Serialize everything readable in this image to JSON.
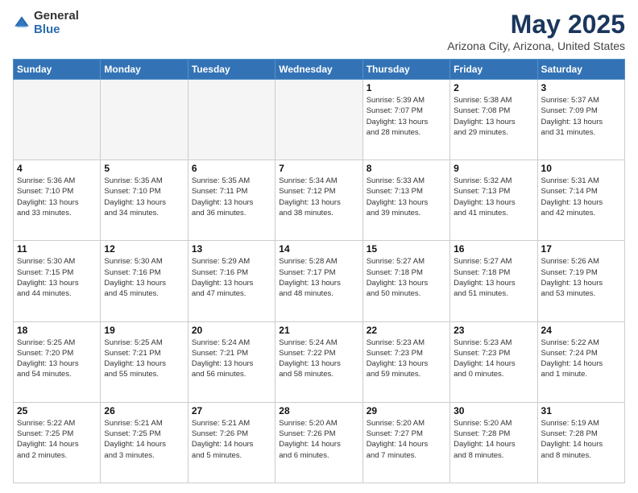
{
  "logo": {
    "general": "General",
    "blue": "Blue"
  },
  "title": "May 2025",
  "subtitle": "Arizona City, Arizona, United States",
  "weekdays": [
    "Sunday",
    "Monday",
    "Tuesday",
    "Wednesday",
    "Thursday",
    "Friday",
    "Saturday"
  ],
  "weeks": [
    [
      {
        "day": "",
        "info": ""
      },
      {
        "day": "",
        "info": ""
      },
      {
        "day": "",
        "info": ""
      },
      {
        "day": "",
        "info": ""
      },
      {
        "day": "1",
        "info": "Sunrise: 5:39 AM\nSunset: 7:07 PM\nDaylight: 13 hours\nand 28 minutes."
      },
      {
        "day": "2",
        "info": "Sunrise: 5:38 AM\nSunset: 7:08 PM\nDaylight: 13 hours\nand 29 minutes."
      },
      {
        "day": "3",
        "info": "Sunrise: 5:37 AM\nSunset: 7:09 PM\nDaylight: 13 hours\nand 31 minutes."
      }
    ],
    [
      {
        "day": "4",
        "info": "Sunrise: 5:36 AM\nSunset: 7:10 PM\nDaylight: 13 hours\nand 33 minutes."
      },
      {
        "day": "5",
        "info": "Sunrise: 5:35 AM\nSunset: 7:10 PM\nDaylight: 13 hours\nand 34 minutes."
      },
      {
        "day": "6",
        "info": "Sunrise: 5:35 AM\nSunset: 7:11 PM\nDaylight: 13 hours\nand 36 minutes."
      },
      {
        "day": "7",
        "info": "Sunrise: 5:34 AM\nSunset: 7:12 PM\nDaylight: 13 hours\nand 38 minutes."
      },
      {
        "day": "8",
        "info": "Sunrise: 5:33 AM\nSunset: 7:13 PM\nDaylight: 13 hours\nand 39 minutes."
      },
      {
        "day": "9",
        "info": "Sunrise: 5:32 AM\nSunset: 7:13 PM\nDaylight: 13 hours\nand 41 minutes."
      },
      {
        "day": "10",
        "info": "Sunrise: 5:31 AM\nSunset: 7:14 PM\nDaylight: 13 hours\nand 42 minutes."
      }
    ],
    [
      {
        "day": "11",
        "info": "Sunrise: 5:30 AM\nSunset: 7:15 PM\nDaylight: 13 hours\nand 44 minutes."
      },
      {
        "day": "12",
        "info": "Sunrise: 5:30 AM\nSunset: 7:16 PM\nDaylight: 13 hours\nand 45 minutes."
      },
      {
        "day": "13",
        "info": "Sunrise: 5:29 AM\nSunset: 7:16 PM\nDaylight: 13 hours\nand 47 minutes."
      },
      {
        "day": "14",
        "info": "Sunrise: 5:28 AM\nSunset: 7:17 PM\nDaylight: 13 hours\nand 48 minutes."
      },
      {
        "day": "15",
        "info": "Sunrise: 5:27 AM\nSunset: 7:18 PM\nDaylight: 13 hours\nand 50 minutes."
      },
      {
        "day": "16",
        "info": "Sunrise: 5:27 AM\nSunset: 7:18 PM\nDaylight: 13 hours\nand 51 minutes."
      },
      {
        "day": "17",
        "info": "Sunrise: 5:26 AM\nSunset: 7:19 PM\nDaylight: 13 hours\nand 53 minutes."
      }
    ],
    [
      {
        "day": "18",
        "info": "Sunrise: 5:25 AM\nSunset: 7:20 PM\nDaylight: 13 hours\nand 54 minutes."
      },
      {
        "day": "19",
        "info": "Sunrise: 5:25 AM\nSunset: 7:21 PM\nDaylight: 13 hours\nand 55 minutes."
      },
      {
        "day": "20",
        "info": "Sunrise: 5:24 AM\nSunset: 7:21 PM\nDaylight: 13 hours\nand 56 minutes."
      },
      {
        "day": "21",
        "info": "Sunrise: 5:24 AM\nSunset: 7:22 PM\nDaylight: 13 hours\nand 58 minutes."
      },
      {
        "day": "22",
        "info": "Sunrise: 5:23 AM\nSunset: 7:23 PM\nDaylight: 13 hours\nand 59 minutes."
      },
      {
        "day": "23",
        "info": "Sunrise: 5:23 AM\nSunset: 7:23 PM\nDaylight: 14 hours\nand 0 minutes."
      },
      {
        "day": "24",
        "info": "Sunrise: 5:22 AM\nSunset: 7:24 PM\nDaylight: 14 hours\nand 1 minute."
      }
    ],
    [
      {
        "day": "25",
        "info": "Sunrise: 5:22 AM\nSunset: 7:25 PM\nDaylight: 14 hours\nand 2 minutes."
      },
      {
        "day": "26",
        "info": "Sunrise: 5:21 AM\nSunset: 7:25 PM\nDaylight: 14 hours\nand 3 minutes."
      },
      {
        "day": "27",
        "info": "Sunrise: 5:21 AM\nSunset: 7:26 PM\nDaylight: 14 hours\nand 5 minutes."
      },
      {
        "day": "28",
        "info": "Sunrise: 5:20 AM\nSunset: 7:26 PM\nDaylight: 14 hours\nand 6 minutes."
      },
      {
        "day": "29",
        "info": "Sunrise: 5:20 AM\nSunset: 7:27 PM\nDaylight: 14 hours\nand 7 minutes."
      },
      {
        "day": "30",
        "info": "Sunrise: 5:20 AM\nSunset: 7:28 PM\nDaylight: 14 hours\nand 8 minutes."
      },
      {
        "day": "31",
        "info": "Sunrise: 5:19 AM\nSunset: 7:28 PM\nDaylight: 14 hours\nand 8 minutes."
      }
    ]
  ]
}
